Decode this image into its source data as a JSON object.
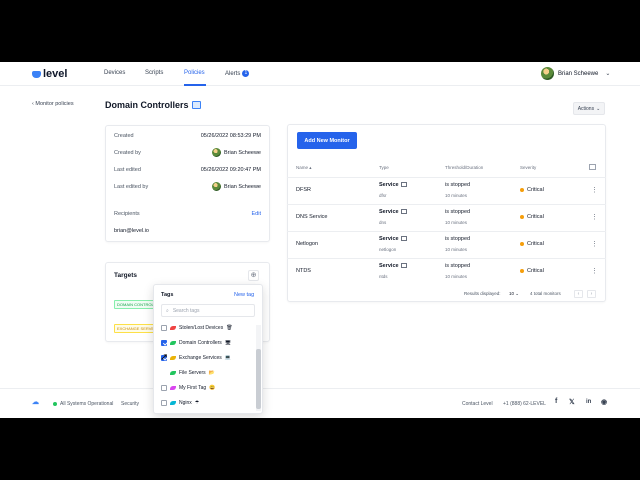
{
  "brand": {
    "name": "level"
  },
  "nav": {
    "items": [
      {
        "label": "Devices"
      },
      {
        "label": "Scripts"
      },
      {
        "label": "Policies"
      },
      {
        "label": "Alerts"
      }
    ],
    "alerts_count": "1",
    "user_name": "Brian Scheewe"
  },
  "page": {
    "back_label": "Monitor policies",
    "title": "Domain Controllers",
    "actions_label": "Actions"
  },
  "details": {
    "created_label": "Created",
    "created_value": "05/26/2022 08:53:29 PM",
    "created_by_label": "Created by",
    "created_by_value": "Brian Scheewe",
    "last_edited_label": "Last edited",
    "last_edited_value": "05/26/2022 09:20:47 PM",
    "last_edited_by_label": "Last edited by",
    "last_edited_by_value": "Brian Scheewe",
    "recipients_label": "Recipients",
    "edit_label": "Edit",
    "recipient_email": "brian@level.io"
  },
  "monitors": {
    "add_button": "Add New Monitor",
    "columns": {
      "name": "Name",
      "type": "Type",
      "threshold": "Threshold/Duration",
      "severity": "Severity"
    },
    "rows": [
      {
        "name": "DFSR",
        "type": "Service",
        "type_sub": "dfsr",
        "threshold": "is stopped",
        "duration": "10 minutes",
        "severity": "Critical"
      },
      {
        "name": "DNS Service",
        "type": "Service",
        "type_sub": "dns",
        "threshold": "is stopped",
        "duration": "10 minutes",
        "severity": "Critical"
      },
      {
        "name": "Netlogon",
        "type": "Service",
        "type_sub": "netlogon",
        "threshold": "is stopped",
        "duration": "10 minutes",
        "severity": "Critical"
      },
      {
        "name": "NTDS",
        "type": "Service",
        "type_sub": "ntds",
        "threshold": "is stopped",
        "duration": "10 minutes",
        "severity": "Critical"
      }
    ],
    "results_label": "Results displayed:",
    "results_value": "10",
    "total_label": "4 total monitors"
  },
  "targets": {
    "title": "Targets",
    "chips": [
      "DOMAIN CONTROLLERS",
      "EXCHANGE SERVERS"
    ]
  },
  "tags_dropdown": {
    "title": "Tags",
    "new_tag": "New tag",
    "search_placeholder": "Search tags",
    "items": [
      {
        "label": "Stolen/Lost Devices",
        "checked": false,
        "color": "#ef4444",
        "emoji": "🗑"
      },
      {
        "label": "Domain Controllers",
        "checked": true,
        "color": "#22c55e",
        "emoji": "🖥"
      },
      {
        "label": "Exchange Services",
        "checked": true,
        "color": "#eab308",
        "emoji": "💻"
      },
      {
        "label": "File Servers",
        "checked": false,
        "color": "#22c55e",
        "emoji": "📂"
      },
      {
        "label": "My First Tag",
        "checked": false,
        "color": "#d946ef",
        "emoji": "😀"
      },
      {
        "label": "Nginx",
        "checked": false,
        "color": "#06b6d4",
        "emoji": "☂"
      }
    ]
  },
  "footer": {
    "status": "All Systems Operational",
    "security": "Security",
    "contact": "Contact Level",
    "phone": "+1 (888) 62-LEVEL"
  },
  "colors": {
    "accent": "#2563eb",
    "critical": "#f59e0b",
    "operational": "#22c55e"
  }
}
